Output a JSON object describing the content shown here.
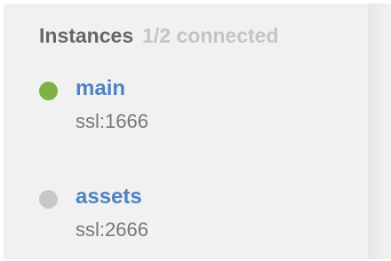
{
  "header": {
    "title": "Instances",
    "status": "1/2 connected"
  },
  "instances": [
    {
      "name": "main",
      "address": "ssl:1666",
      "status": "connected",
      "status_color": "#7cb342"
    },
    {
      "name": "assets",
      "address": "ssl:2666",
      "status": "disconnected",
      "status_color": "#c8c8c8"
    }
  ],
  "colors": {
    "panel_bg": "#f1f1f1",
    "link": "#4f82c1",
    "title": "#666666",
    "muted": "#c4c4c4"
  }
}
